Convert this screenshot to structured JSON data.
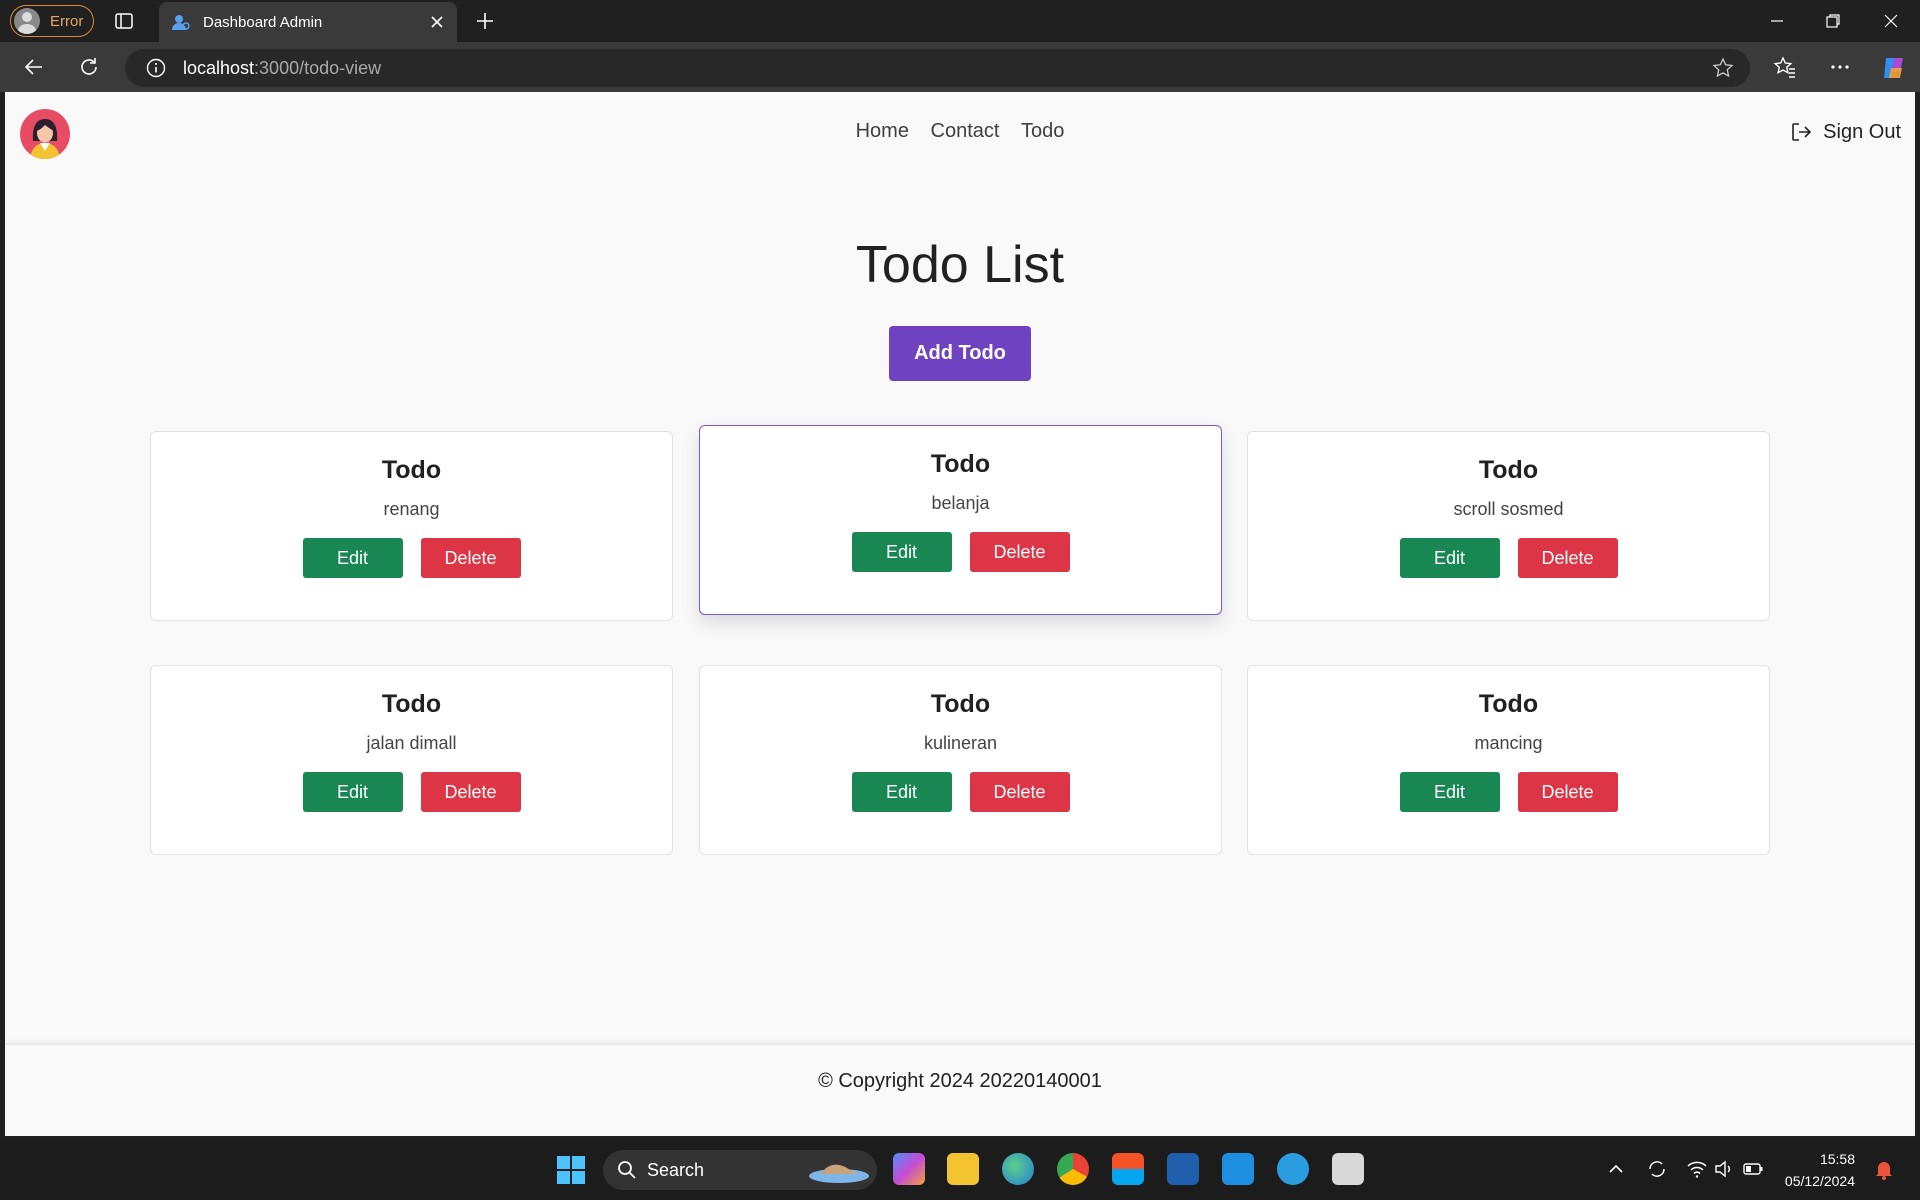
{
  "browser": {
    "profile_label": "Error",
    "tab_title": "Dashboard Admin",
    "url_host": "localhost",
    "url_path": ":3000/todo-view"
  },
  "nav": {
    "links": [
      "Home",
      "Contact",
      "Todo"
    ],
    "signout_label": "Sign Out"
  },
  "main": {
    "title": "Todo List",
    "add_button": "Add Todo",
    "todos": [
      {
        "heading": "Todo",
        "text": "renang",
        "edit": "Edit",
        "delete": "Delete"
      },
      {
        "heading": "Todo",
        "text": "belanja",
        "edit": "Edit",
        "delete": "Delete"
      },
      {
        "heading": "Todo",
        "text": "scroll sosmed",
        "edit": "Edit",
        "delete": "Delete"
      },
      {
        "heading": "Todo",
        "text": "jalan dimall",
        "edit": "Edit",
        "delete": "Delete"
      },
      {
        "heading": "Todo",
        "text": "kulineran",
        "edit": "Edit",
        "delete": "Delete"
      },
      {
        "heading": "Todo",
        "text": "mancing",
        "edit": "Edit",
        "delete": "Delete"
      }
    ]
  },
  "footer": {
    "copyright": "© Copyright 2024 20220140001"
  },
  "taskbar": {
    "search_label": "Search",
    "time": "15:58",
    "date": "05/12/2024"
  },
  "colors": {
    "accent": "#6f42c1",
    "edit": "#198754",
    "delete": "#dc3545"
  }
}
